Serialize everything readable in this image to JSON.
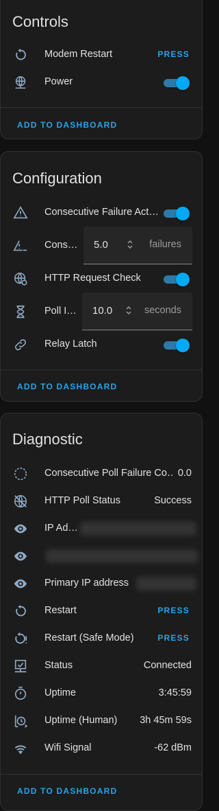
{
  "controls": {
    "title": "Controls",
    "rows": [
      {
        "label": "Modem Restart",
        "action": "PRESS",
        "icon": "restart-icon"
      },
      {
        "label": "Power",
        "state": "on",
        "icon": "globe-icon"
      }
    ],
    "add_to_dashboard": "ADD TO DASHBOARD"
  },
  "configuration": {
    "title": "Configuration",
    "rows": [
      {
        "label": "Consecutive Failure Act…",
        "state": "on",
        "icon": "alert-icon"
      },
      {
        "label": "Cons…",
        "value": "5.0",
        "unit": "failures",
        "icon": "alert-minus-icon"
      },
      {
        "label": "HTTP Request Check",
        "state": "on",
        "icon": "web-sync-icon"
      },
      {
        "label": "Poll I…",
        "value": "10.0",
        "unit": "seconds",
        "icon": "hourglass-icon"
      },
      {
        "label": "Relay Latch",
        "state": "on",
        "icon": "link-icon"
      }
    ],
    "add_to_dashboard": "ADD TO DASHBOARD"
  },
  "diagnostic": {
    "title": "Diagnostic",
    "rows": [
      {
        "label": "Consecutive Poll Failure Co…",
        "value": "0.0",
        "icon": "timer-dashed-icon"
      },
      {
        "label": "HTTP Poll Status",
        "value": "Success",
        "icon": "web-off-icon"
      },
      {
        "label": "IP Ad…",
        "value": "",
        "icon": "eye-icon"
      },
      {
        "label": "",
        "value": "",
        "icon": "eye-icon"
      },
      {
        "label": "Primary IP address",
        "value": "",
        "icon": "eye-icon"
      },
      {
        "label": "Restart",
        "action": "PRESS",
        "icon": "restart-icon"
      },
      {
        "label": "Restart (Safe Mode)",
        "action": "PRESS",
        "icon": "restart-alert-icon"
      },
      {
        "label": "Status",
        "value": "Connected",
        "icon": "monitor-check-icon"
      },
      {
        "label": "Uptime",
        "value": "3:45:59",
        "icon": "timer-icon"
      },
      {
        "label": "Uptime (Human)",
        "value": "3h 45m 59s",
        "icon": "clock-arrow-icon"
      },
      {
        "label": "Wifi Signal",
        "value": "-62 dBm",
        "icon": "wifi-icon"
      }
    ],
    "add_to_dashboard": "ADD TO DASHBOARD"
  },
  "colors": {
    "accent": "#03a9f4",
    "action_text": "#2aa3e8",
    "icon": "#8fa8c4",
    "card_bg": "#1c1c1c",
    "page_bg": "#111111"
  }
}
